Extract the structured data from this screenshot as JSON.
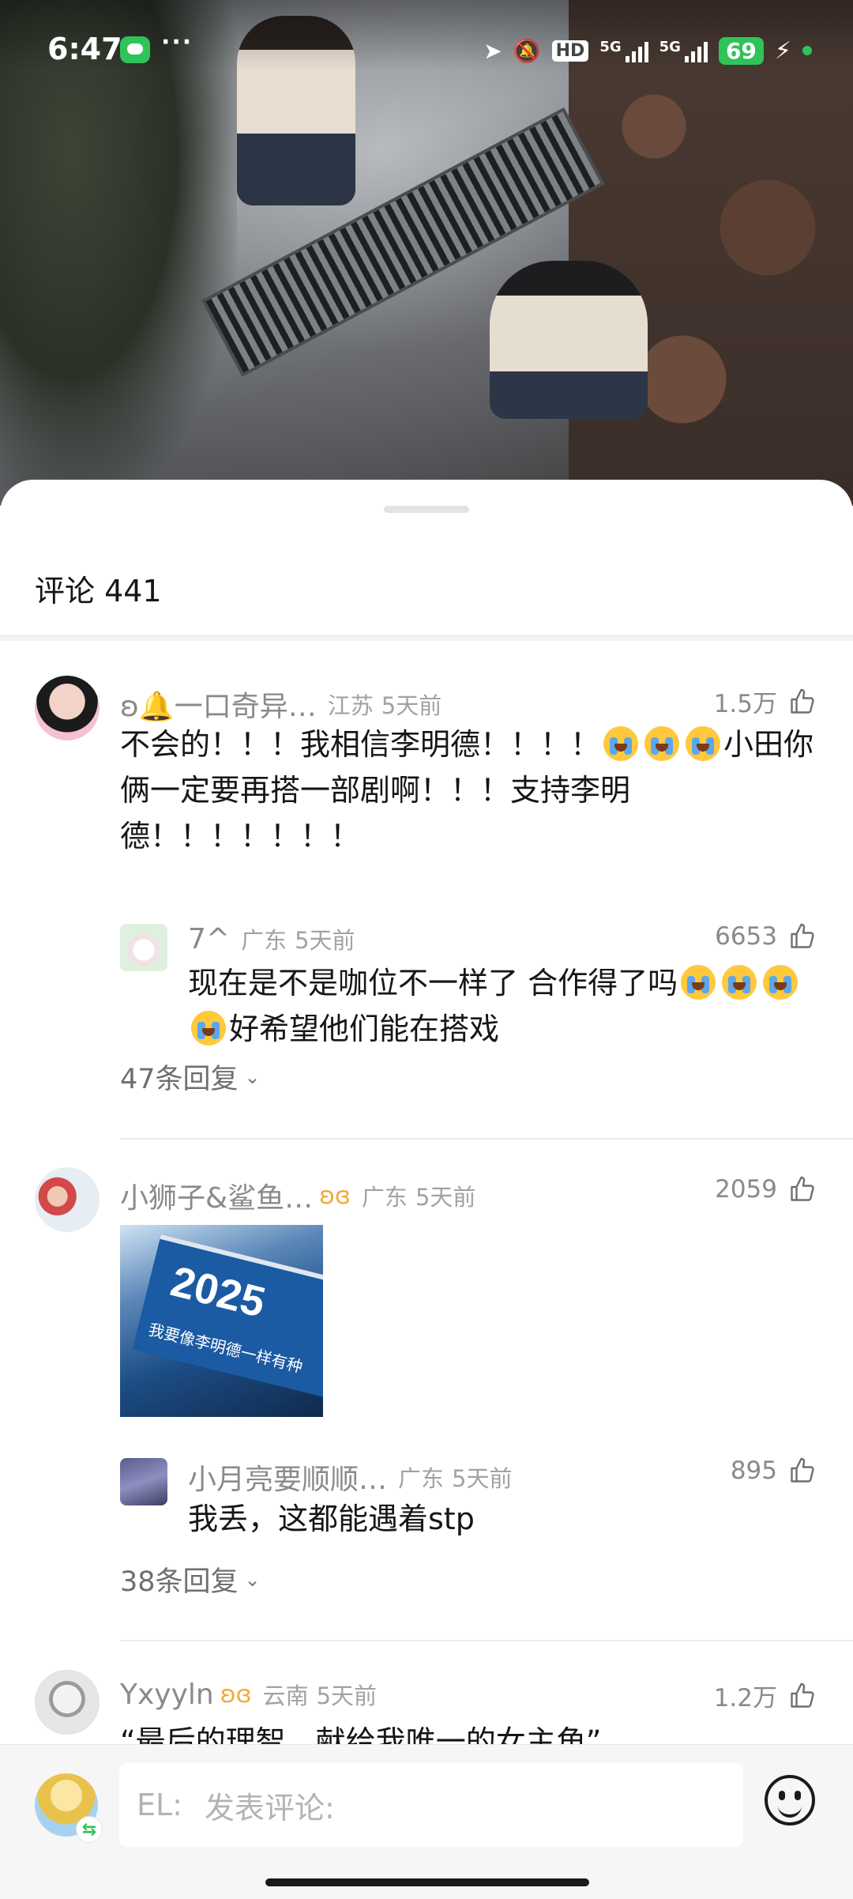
{
  "status_bar": {
    "time": "6:47",
    "more": "···",
    "hd": "HD",
    "sig1": "5G",
    "sig2": "5G",
    "battery": "69"
  },
  "sheet": {
    "title": "评论 441"
  },
  "comments": [
    {
      "user": "ʚ🔔一口奇异…",
      "location": "江苏",
      "time": "5天前",
      "likes": "1.5万",
      "text_a": "不会的！！！我相信李明德！！！！",
      "text_b": "小田你俩一定要再搭一部剧啊！！！支持李明德！！！！！！！",
      "reply": {
        "user": "7^",
        "location": "广东",
        "time": "5天前",
        "likes": "6653",
        "text_a": "现在是不是咖位不一样了 合作得了吗",
        "text_b": "好希望他们能在搭戏"
      },
      "expand": "47条回复"
    },
    {
      "user": "小狮子&鲨鱼…",
      "location": "广东",
      "time": "5天前",
      "likes": "2059",
      "image_year": "2025",
      "image_caption": "我要像李明德一样有种",
      "reply": {
        "user": "小月亮要顺顺…",
        "location": "广东",
        "time": "5天前",
        "likes": "895",
        "text": "我丢，这都能遇着stp"
      },
      "expand": "38条回复"
    },
    {
      "user": "Yxyyln",
      "location": "云南",
      "time": "5天前",
      "likes": "1.2万",
      "text": "“最后的理智，献给我唯一的女主角”"
    }
  ],
  "input_bar": {
    "prefix": "EL:",
    "placeholder": "发表评论:"
  },
  "colors": {
    "accent_green": "#2fc35a",
    "vip_gold": "#f0a93a",
    "secondary_text": "#8a8a8a"
  }
}
